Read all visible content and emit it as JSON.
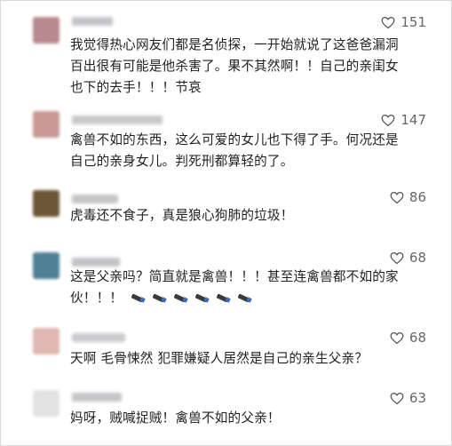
{
  "comments": [
    {
      "likes": "151",
      "text": "我觉得热心网友们都是名侦探，一开始就说了这爸爸漏洞\n百出很有可能是他杀害了。果不其然啊！！自己的亲闺女\n也下的去手！！！节哀",
      "avatar_color": "#b8898f",
      "name_color": "#c4c4c8"
    },
    {
      "likes": "147",
      "text": "禽兽不如的东西，这么可爱的女儿也下得了手。何况还是\n自己的亲身女儿。判死刑都算轻的了。",
      "avatar_color": "#c99a94",
      "name_color": "#c9c9cc"
    },
    {
      "likes": "86",
      "text": "虎毒还不食子，真是狼心狗肺的垃圾！",
      "avatar_color": "#6c5636",
      "name_color": "#c6c6c9"
    },
    {
      "likes": "68",
      "text": "这是父亲吗？简直就是禽兽！！！甚至连禽兽都不如的家\n伙！！！",
      "avatar_color": "#4f7f96",
      "name_color": "#c4c4c8"
    },
    {
      "likes": "68",
      "text": "天啊 毛骨悚然 犯罪嫌疑人居然是自己的亲生父亲？",
      "avatar_color": "#e0b7b2",
      "name_color": "#cbcbce"
    },
    {
      "likes": "63",
      "text": "妈呀，贼喊捉贼！禽兽不如的父亲！",
      "avatar_color": "#e3e3e3",
      "name_color": "#c6c6c9"
    }
  ],
  "icons": {
    "like": "thumbs-up-icon",
    "reaction": "torch-emoji-icon"
  },
  "colors": {
    "text": "#1f1f1f",
    "likes": "#666666",
    "border": "#d9d9d9"
  }
}
